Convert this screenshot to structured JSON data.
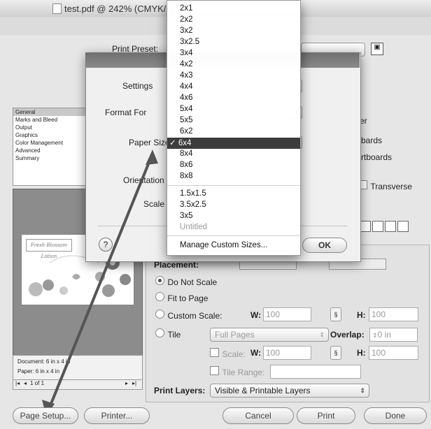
{
  "window": {
    "title": "test.pdf @ 242% (CMYK/Pr"
  },
  "print_dialog": {
    "print_preset_label": "Print Preset:",
    "categories": [
      "General",
      "Marks and Bleed",
      "Output",
      "Graphics",
      "Color Management",
      "Advanced",
      "Summary"
    ],
    "right_fragments": {
      "er": "er",
      "boards": "bards",
      "artboards": "rtboards",
      "transverse": "Transverse"
    },
    "placement_label": "Placement:",
    "scaling": {
      "do_not_scale": "Do Not Scale",
      "fit_to_page": "Fit to Page",
      "custom_scale": "Custom Scale:",
      "tile": "Tile",
      "w_label": "W:",
      "h_label": "H:",
      "w_value": "100",
      "h_value": "100",
      "tile_mode": "Full Pages",
      "overlap_label": "Overlap:",
      "overlap_value": "0 in",
      "scale_label": "Scale:",
      "scale_w_value": "100",
      "scale_h_value": "100",
      "tile_range_label": "Tile Range:"
    },
    "print_layers_label": "Print Layers:",
    "print_layers_value": "Visible & Printable Layers",
    "preview_info": {
      "document": "Document: 6 in x 4 in",
      "paper": "Paper: 6 in x 4 in"
    },
    "page_nav": "1 of 1",
    "buttons": {
      "page_setup": "Page Setup...",
      "printer": "Printer...",
      "cancel": "Cancel",
      "print": "Print",
      "done": "Done"
    }
  },
  "page_setup_sheet": {
    "settings_label": "Settings",
    "format_for_label": "Format For",
    "paper_size_label": "Paper Size",
    "orientation_label": "Orientation",
    "scale_label": "Scale",
    "ok_label": "OK",
    "help_label": "?"
  },
  "paper_menu": {
    "group1": [
      "2x1",
      "2x2",
      "3x2",
      "3x2.5",
      "3x4",
      "4x2",
      "4x3",
      "4x4",
      "4x6",
      "5x4",
      "5x5",
      "6x2"
    ],
    "selected": "6x4",
    "group2": [
      "8x4",
      "8x6",
      "8x8"
    ],
    "group3": [
      "1.5x1.5",
      "3.5x2.5",
      "3x5"
    ],
    "untitled": "Untitled",
    "manage": "Manage Custom Sizes...",
    "checkmark": "✓"
  },
  "preview_card_text": "Fresh Blossom Lotion",
  "colors": {
    "menu_highlight": "#3c3c3c",
    "arrow": "#555555"
  }
}
